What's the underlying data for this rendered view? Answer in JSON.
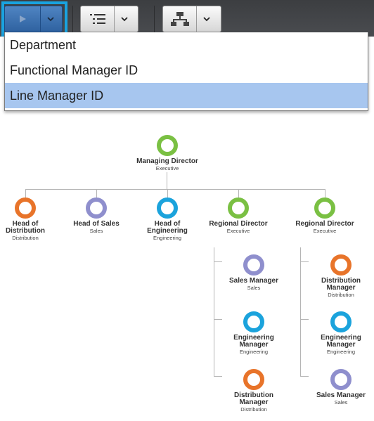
{
  "toolbar": {
    "play_icon": "play-icon",
    "list_icon": "list-icon",
    "hierarchy_icon": "hierarchy-icon",
    "chevron_icon": "chevron-down-icon"
  },
  "dropdown": {
    "items": [
      "Department",
      "Functional Manager ID",
      "Line Manager ID"
    ],
    "selected": "Line Manager ID"
  },
  "colors": {
    "Executive": "#7ac043",
    "Distribution": "#e8742a",
    "Sales": "#8f8fcd",
    "Engineering": "#1ba3dc",
    "selection": "#a7c6ef",
    "toolbar_focus": "#19a3e0"
  },
  "org": {
    "root": {
      "title": "Managing Director",
      "dept": "Executive"
    },
    "level1": [
      {
        "title": "Head of Distribution",
        "dept": "Distribution"
      },
      {
        "title": "Head of Sales",
        "dept": "Sales"
      },
      {
        "title": "Head of Engineering",
        "dept": "Engineering"
      },
      {
        "title": "Regional Director",
        "dept": "Executive"
      },
      {
        "title": "Regional Director",
        "dept": "Executive"
      }
    ],
    "rd1_reports": [
      {
        "title": "Sales Manager",
        "dept": "Sales"
      },
      {
        "title": "Engineering Manager",
        "dept": "Engineering"
      },
      {
        "title": "Distribution Manager",
        "dept": "Distribution"
      }
    ],
    "rd2_reports": [
      {
        "title": "Distribution Manager",
        "dept": "Distribution"
      },
      {
        "title": "Engineering Manager",
        "dept": "Engineering"
      },
      {
        "title": "Sales Manager",
        "dept": "Sales"
      }
    ]
  }
}
